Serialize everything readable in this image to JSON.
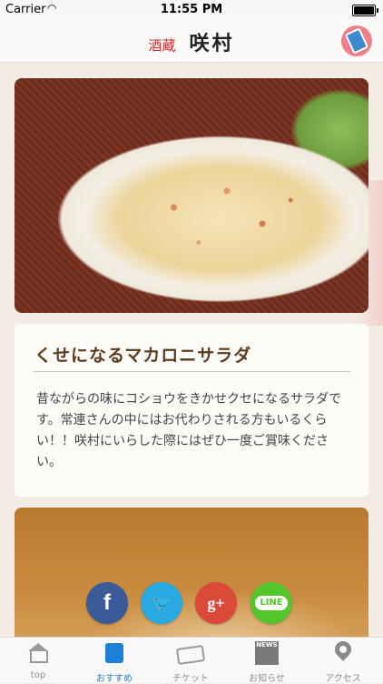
{
  "status_bar": {
    "carrier": "Carrier",
    "time": "11:55 PM"
  },
  "header": {
    "logo_small": "酒蔵",
    "logo_big": "咲村"
  },
  "article": {
    "title": "くせになるマカロニサラダ",
    "body": "昔ながらの味にコショウをきかせクセになるサラダです。常連さんの中にはお代わりされる方もいるくらい！！咲村にいらした際にはぜひ一度ご賞味ください。"
  },
  "share": {
    "facebook": "f",
    "twitter": "t",
    "googleplus": "g+",
    "line": "LINE"
  },
  "tabs": [
    {
      "label": "top",
      "icon": "home-icon",
      "active": false
    },
    {
      "label": "おすすめ",
      "icon": "recommend-icon",
      "active": true
    },
    {
      "label": "チケット",
      "icon": "ticket-icon",
      "active": false
    },
    {
      "label": "お知らせ",
      "icon": "news-icon",
      "active": false
    },
    {
      "label": "アクセス",
      "icon": "map-pin-icon",
      "active": false
    }
  ],
  "news_icon_text": "NEWS",
  "colors": {
    "accent": "#1e7fd6",
    "title": "#5a3b1e",
    "logo_red": "#d42a2a"
  }
}
